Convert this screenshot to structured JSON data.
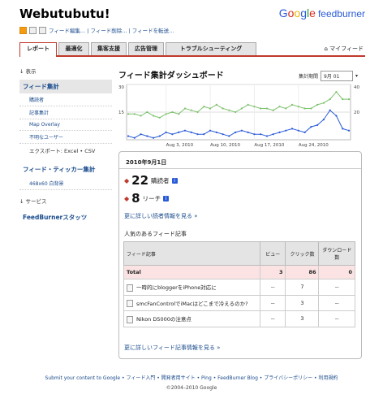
{
  "header": {
    "title": "Webutubutu!",
    "logo_google": [
      "G",
      "o",
      "o",
      "g",
      "l",
      "e"
    ],
    "logo_product": "feedburner",
    "toolbar_links": "フィード編集... | フィード削除... | フィードを転送..."
  },
  "tabs": [
    "レポート",
    "最適化",
    "集客支援",
    "広告管理",
    "トラブルシューティング"
  ],
  "myfeed": "マイフィード",
  "sidebar": {
    "display_label": "表示",
    "current": "フィード集計",
    "sub_items": [
      "購読者",
      "記事集計",
      "Map Overlay",
      "不明なユーザー"
    ],
    "export": "エクスポート: Excel • CSV",
    "ticker": "フィード・ティッカー集計",
    "ticker_sub": "468x60 白背景",
    "services_label": "サービス",
    "stats": "FeedBurnerスタッツ"
  },
  "dashboard": {
    "title": "フィード集計ダッシュボード",
    "period_label": "集計期間",
    "period_value": "9月 01"
  },
  "chart_data": {
    "type": "line",
    "x": [
      "Jul 28",
      "Jul 29",
      "Jul 30",
      "Jul 31",
      "Aug 1",
      "Aug 2",
      "Aug 3",
      "Aug 4",
      "Aug 5",
      "Aug 6",
      "Aug 7",
      "Aug 8",
      "Aug 9",
      "Aug 10",
      "Aug 11",
      "Aug 12",
      "Aug 13",
      "Aug 14",
      "Aug 15",
      "Aug 16",
      "Aug 17",
      "Aug 18",
      "Aug 19",
      "Aug 20",
      "Aug 21",
      "Aug 22",
      "Aug 23",
      "Aug 24",
      "Aug 25",
      "Aug 26",
      "Aug 27",
      "Aug 28",
      "Aug 29",
      "Aug 30",
      "Aug 31",
      "Sep 1"
    ],
    "xticks": [
      "Aug 3, 2010",
      "Aug 10, 2010",
      "Aug 17, 2010",
      "Aug 24, 2010"
    ],
    "ylim_left": [
      0,
      30
    ],
    "yticks_left": [
      "30",
      "15"
    ],
    "ylim_right": [
      0,
      40
    ],
    "yticks_right": [
      "40",
      "20"
    ],
    "series": [
      {
        "color": "#7cc26a",
        "values": [
          14,
          14,
          13,
          15,
          13,
          12,
          14,
          15,
          14,
          17,
          16,
          15,
          18,
          17,
          19,
          17,
          16,
          15,
          17,
          19,
          18,
          17,
          17,
          16,
          18,
          17,
          19,
          18,
          17,
          17,
          19,
          20,
          22,
          26,
          22,
          22
        ]
      },
      {
        "color": "#2a5bd7",
        "values": [
          2,
          1,
          3,
          2,
          1,
          2,
          4,
          3,
          4,
          5,
          4,
          3,
          3,
          5,
          4,
          3,
          2,
          4,
          5,
          4,
          3,
          3,
          2,
          3,
          4,
          5,
          6,
          5,
          4,
          7,
          8,
          11,
          16,
          13,
          6,
          5
        ]
      }
    ]
  },
  "panel": {
    "date": "2010年9月1日",
    "subscribers_num": "22",
    "subscribers_label": "購読者",
    "reach_num": "8",
    "reach_label": "リーチ",
    "more_subscribers": "更に詳しい読者情報を見る »",
    "popular_title": "人気のあるフィード記事",
    "table_headers": [
      "フィード記事",
      "ビュー",
      "クリック数",
      "ダウンロード数"
    ],
    "total_row": [
      "Total",
      "3",
      "86",
      "0"
    ],
    "rows": [
      [
        "一時的にbloggerをiPhone対応に",
        "--",
        "7",
        "--"
      ],
      [
        "smcFanControlでiMacはどこまで冷えるのか?",
        "--",
        "3",
        "--"
      ],
      [
        "Nikon D5000の注意点",
        "--",
        "3",
        "--"
      ]
    ],
    "more_items": "更に詳しいフィード記事情報を見る »"
  },
  "footer": {
    "links": "Submit your content to Google • フィード入門 • 開発者用サイト • Ping • FeedBurner Blog • プライバシーポリシー • 利用規約",
    "copyright": "©2004–2010 Google"
  }
}
